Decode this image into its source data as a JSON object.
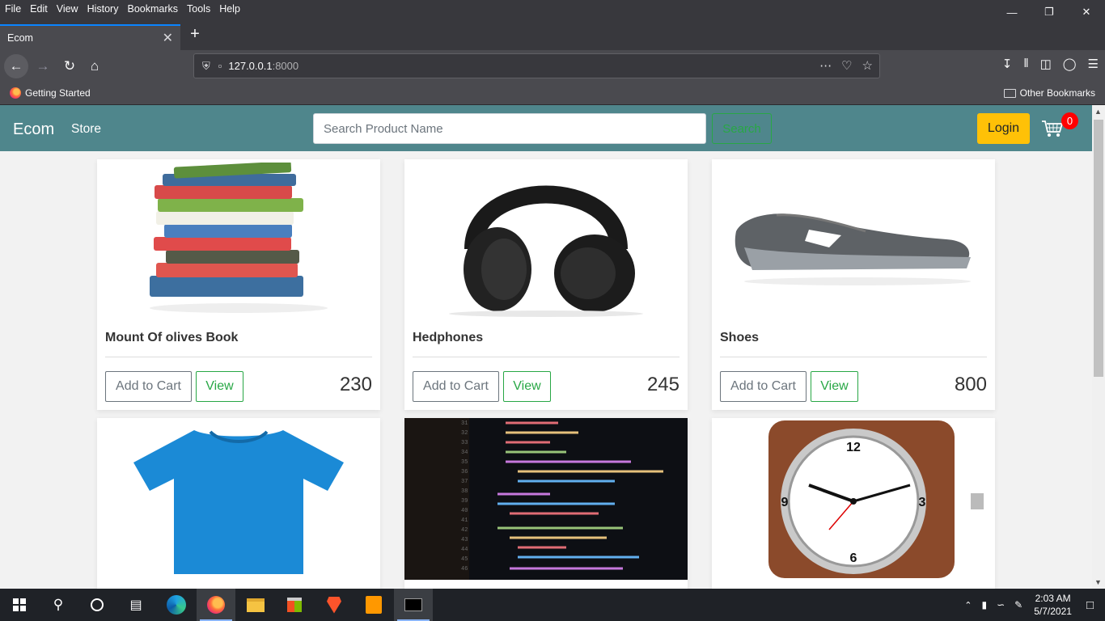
{
  "browser": {
    "menu": [
      "File",
      "Edit",
      "View",
      "History",
      "Bookmarks",
      "Tools",
      "Help"
    ],
    "tab_title": "Ecom",
    "url_host": "127.0.0.1",
    "url_port": ":8000",
    "bookmark_getting_started": "Getting Started",
    "bookmark_other": "Other Bookmarks"
  },
  "site": {
    "brand": "Ecom",
    "store_link": "Store",
    "search_placeholder": "Search Product Name",
    "search_button": "Search",
    "login_button": "Login",
    "cart_count": "0"
  },
  "products": [
    {
      "name": "Mount Of olives Book",
      "price": "230",
      "add_label": "Add to Cart",
      "view_label": "View"
    },
    {
      "name": "Hedphones",
      "price": "245",
      "add_label": "Add to Cart",
      "view_label": "View"
    },
    {
      "name": "Shoes",
      "price": "800",
      "add_label": "Add to Cart",
      "view_label": "View"
    }
  ],
  "taskbar": {
    "time": "2:03 AM",
    "date": "5/7/2021"
  },
  "colors": {
    "navbar": "#4f868c",
    "login": "#ffc107",
    "success": "#28a745",
    "cart_badge": "#ff0000"
  }
}
